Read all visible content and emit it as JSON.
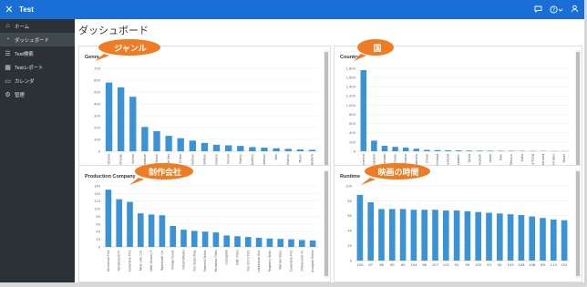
{
  "header": {
    "app_name": "Test",
    "close_icon": "close-icon",
    "icons": [
      "chat-icon",
      "help-icon",
      "user-icon"
    ]
  },
  "sidebar": {
    "items": [
      {
        "label": "ホーム",
        "icon": "home-icon",
        "active": false
      },
      {
        "label": "ダッシュボード",
        "icon": "dashboard-icon",
        "active": true
      },
      {
        "label": "Test検索",
        "icon": "list-icon",
        "active": false
      },
      {
        "label": "Testレポート",
        "icon": "report-icon",
        "active": false
      },
      {
        "label": "カレンダ",
        "icon": "calendar-icon",
        "active": false
      },
      {
        "label": "管理",
        "icon": "admin-icon",
        "active": false
      }
    ]
  },
  "page": {
    "title": "ダッシュボード"
  },
  "callouts": {
    "genre": "ジャンル",
    "country": "国",
    "company": "制作会社",
    "runtime": "映画の時間"
  },
  "accent_color": "#1a6fd6",
  "bar_color": "#3a93d4",
  "callout_color": "#ef7b22",
  "chart_data": [
    {
      "id": "genre",
      "type": "bar",
      "title": "Genre",
      "ylim": [
        0,
        700
      ],
      "yticks": [
        0,
        100,
        200,
        300,
        400,
        500,
        600,
        700
      ],
      "categories": [
        "Drama",
        "Comedy",
        "Action",
        "Adventure",
        "Horror",
        "Thriller",
        "Crime",
        "Documentary",
        "Fantasy",
        "Romance",
        "Science Fiction",
        "Family",
        "Mystery",
        "Documentary",
        "War",
        "History",
        "Music",
        "Western"
      ],
      "values": [
        580,
        540,
        460,
        205,
        170,
        130,
        110,
        90,
        70,
        55,
        50,
        45,
        35,
        30,
        25,
        20,
        15,
        12
      ]
    },
    {
      "id": "country",
      "type": "bar",
      "title": "Country",
      "ylim": [
        0,
        1800
      ],
      "yticks": [
        0,
        200,
        400,
        600,
        800,
        1000,
        1200,
        1400,
        1600,
        1800
      ],
      "categories": [
        "United States of America",
        "United Kingdom",
        "Canada",
        "Germany",
        "France",
        "Australia",
        "China",
        "Ireland",
        "New Zealand",
        "Czech Republic",
        "Spain",
        "Belgium",
        "Japan",
        "Italy",
        "Mexico",
        "India",
        "Hong Kong",
        "Switzerland",
        "United Arab Emirates",
        "Brazil"
      ],
      "values": [
        1760,
        230,
        120,
        95,
        80,
        55,
        30,
        25,
        20,
        18,
        15,
        13,
        12,
        10,
        9,
        8,
        7,
        6,
        5,
        4
      ]
    },
    {
      "id": "company",
      "type": "bar",
      "title": "Production Company",
      "ylim": [
        0,
        160
      ],
      "yticks": [
        0,
        20,
        40,
        60,
        80,
        100,
        120,
        140,
        160
      ],
      "categories": [
        "Universal Pict.",
        "Paramount Pi.",
        "Columbia Pict.",
        "New Line Cin.",
        "Walt Disney P.",
        "Twentieth Ce.",
        "Village Road.",
        "DreamWorks",
        "Fox Searchlig.",
        "Summit Enter.",
        "Miramax Films",
        "Lionsgate",
        "BBC Films",
        "Fox 2000 Pict.",
        "Lakeshore Ent.",
        "Regency Ente.",
        "Warner Bros.",
        "Columbia Pict.",
        "Dimension Fil.",
        "Imagine Enter."
      ],
      "values": [
        150,
        125,
        118,
        88,
        85,
        83,
        55,
        45,
        42,
        40,
        38,
        30,
        28,
        26,
        24,
        22,
        21,
        20,
        18,
        17
      ]
    },
    {
      "id": "runtime",
      "type": "bar",
      "title": "Runtime",
      "ylim": [
        0,
        100
      ],
      "yticks": [
        0,
        20,
        40,
        60,
        80,
        100
      ],
      "categories": [
        "100",
        "97",
        "98",
        "95",
        "90",
        "104",
        "96",
        "107",
        "102",
        "92",
        "99",
        "105",
        "93",
        "94",
        "103",
        "106",
        "108",
        "89",
        "113",
        "101"
      ],
      "values": [
        88,
        78,
        69,
        69,
        69,
        68,
        68,
        68,
        67,
        67,
        66,
        65,
        64,
        63,
        62,
        61,
        59,
        57,
        55,
        54
      ]
    }
  ]
}
